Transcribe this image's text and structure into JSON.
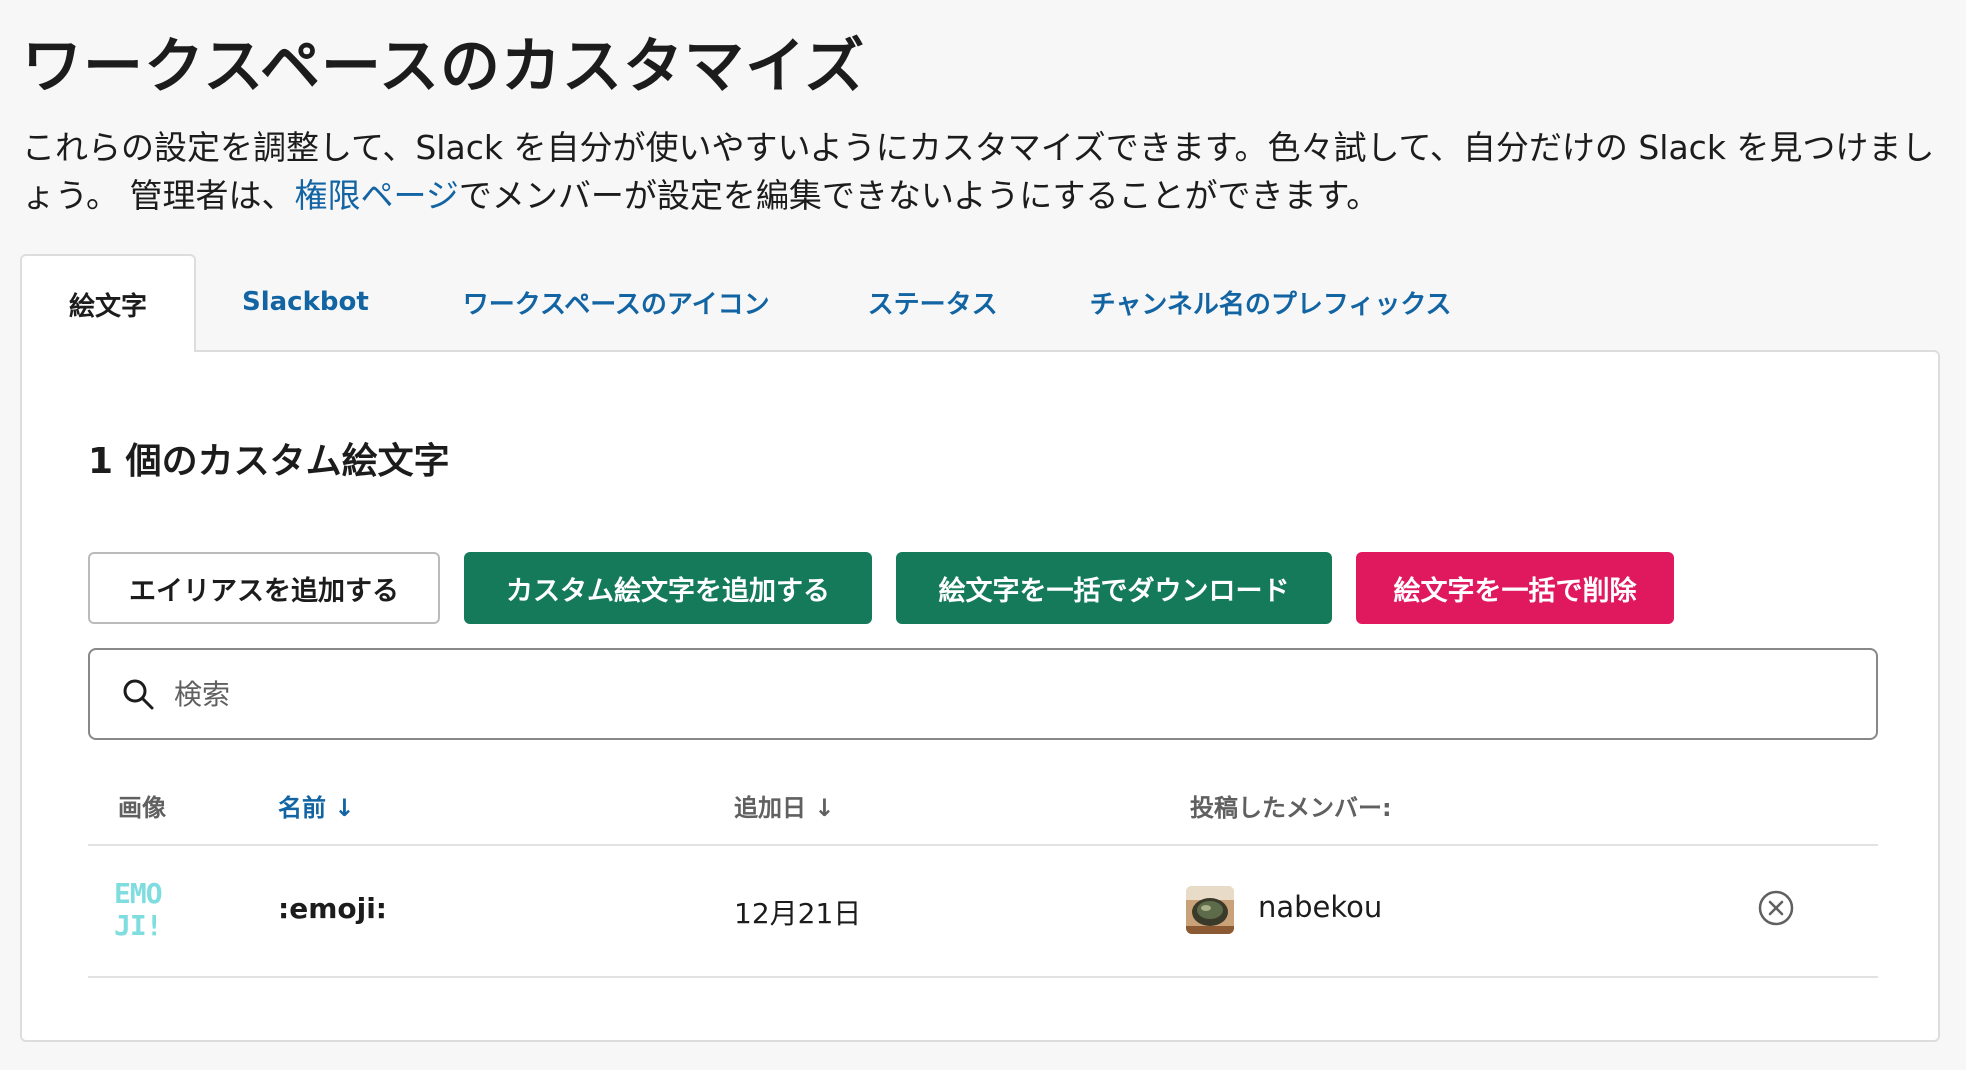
{
  "page": {
    "title": "ワークスペースのカスタマイズ",
    "intro_before": "これらの設定を調整して、Slack を自分が使いやすいようにカスタマイズできます。色々試して、自分だけの Slack を見つけましょう。 管理者は、",
    "intro_link": "権限ページ",
    "intro_after": "でメンバーが設定を編集できないようにすることができます。"
  },
  "tabs": [
    {
      "label": "絵文字",
      "active": true
    },
    {
      "label": "Slackbot",
      "active": false
    },
    {
      "label": "ワークスペースのアイコン",
      "active": false
    },
    {
      "label": "ステータス",
      "active": false
    },
    {
      "label": "チャンネル名のプレフィックス",
      "active": false
    }
  ],
  "section": {
    "title": "1 個のカスタム絵文字"
  },
  "buttons": {
    "add_alias": "エイリアスを追加する",
    "add_custom": "カスタム絵文字を追加する",
    "bulk_download": "絵文字を一括でダウンロード",
    "bulk_delete": "絵文字を一括で削除"
  },
  "search": {
    "placeholder": "検索"
  },
  "table": {
    "headers": {
      "image": "画像",
      "name": "名前 ↓",
      "date": "追加日 ↓",
      "member": "投稿したメンバー:"
    },
    "rows": [
      {
        "image_text_1": "EMO",
        "image_text_2": "JI!",
        "name": ":emoji:",
        "date": "12月21日",
        "member": "nabekou"
      }
    ]
  },
  "colors": {
    "link": "#1264a3",
    "green": "#147a5a",
    "danger": "#e0195e",
    "emoji_tint": "#7fdde0"
  }
}
